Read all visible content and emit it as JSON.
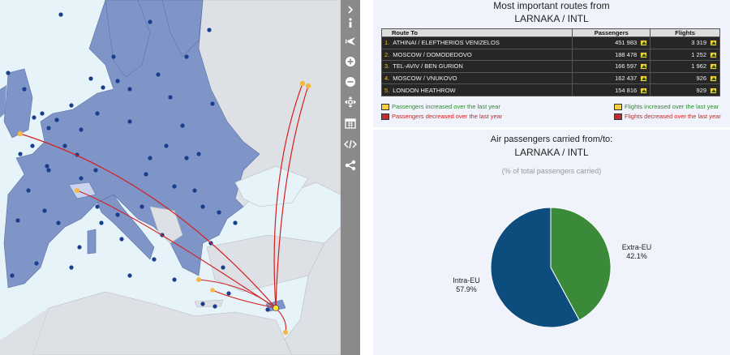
{
  "toolbar": {
    "icons": [
      "collapse-chevron-icon",
      "info-icon",
      "plane-icon",
      "zoom-in-icon",
      "zoom-out-icon",
      "pan-icon",
      "calendar-icon",
      "embed-code-icon",
      "share-icon"
    ]
  },
  "routes_panel": {
    "title": "Most important routes from",
    "airport": "LARNAKA / INTL",
    "columns": [
      "Route To",
      "Passengers",
      "Flights"
    ],
    "rows": [
      {
        "rank": "1.",
        "route": "ATHINAI / ELEFTHERIOS VENIZELOS",
        "passengers": "451 983",
        "flights": "3 319"
      },
      {
        "rank": "2.",
        "route": "MOSCOW / DOMODEDOVO",
        "passengers": "188 478",
        "flights": "1 252"
      },
      {
        "rank": "3.",
        "route": "TEL-AVIV / BEN GURION",
        "passengers": "166 597",
        "flights": "1 962"
      },
      {
        "rank": "4.",
        "route": "MOSCOW / VNUKOVO",
        "passengers": "162 437",
        "flights": "926"
      },
      {
        "rank": "5.",
        "route": "LONDON HEATHROW",
        "passengers": "154 816",
        "flights": "929"
      }
    ],
    "legend": {
      "pax_up": "Passengers increased over the last year",
      "pax_down": "Passengers decreased over the last year",
      "flights_up": "Flights increased over the last year",
      "flights_down": "Flights decreased over the last year"
    }
  },
  "pie_panel": {
    "title": "Air passengers carried from/to:",
    "airport": "LARNAKA / INTL",
    "subtitle": "(% of total passengers carried)",
    "slices": [
      {
        "label": "Extra-EU",
        "value": 42.1,
        "display": "42.1%",
        "color": "#3a8a3a"
      },
      {
        "label": "Intra-EU",
        "value": 57.9,
        "display": "57.9%",
        "color": "#0d4d7e"
      }
    ]
  },
  "colors": {
    "sea": "#e6f3f8",
    "eu_land": "#7f95c8",
    "non_eu_land": "#dde0e4",
    "highlight_land": "#c9d3ef",
    "route_line": "#d42020",
    "airport_dot": "#1a3e8c",
    "route_airport": "#f6b840",
    "toolbar": "#8a8a8a"
  }
}
